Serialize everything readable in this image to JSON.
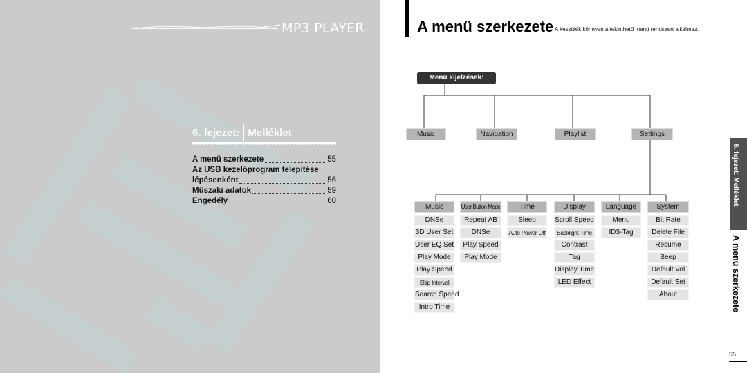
{
  "left_page": {
    "logo_text": "MP3 PLAYER",
    "chapter": {
      "number": "6. fejezet:",
      "name": "Melléklet"
    },
    "toc": [
      {
        "title": "A menü szerkezete",
        "page": "55"
      },
      {
        "title": "Az USB kezelőprogram telepítése",
        "page": ""
      },
      {
        "title": "lépésenként",
        "page": "56"
      },
      {
        "title": "Műszaki adatok",
        "page": "59"
      },
      {
        "title": "Engedély",
        "page": "60"
      }
    ]
  },
  "right_page": {
    "title": "A menü szerkezete",
    "subtitle": "A készülék könnyen áttekinthető menü rendszert alkalmaz.",
    "root": "Menü kijelzések:",
    "level1": [
      "Music",
      "Navigation",
      "Playlist",
      "Settings"
    ],
    "settings_children": [
      {
        "label": "Music",
        "items": [
          "DNSe",
          "3D User Set",
          "User EQ Set",
          "Play Mode",
          "Play Speed",
          "Skip Interval",
          "Search Speed",
          "Intro Time"
        ]
      },
      {
        "label": "User Button Mode",
        "items": [
          "Repeat AB",
          "DNSe",
          "Play Speed",
          "Play Mode"
        ]
      },
      {
        "label": "Time",
        "items": [
          "Sleep",
          "Auto Power Off"
        ]
      },
      {
        "label": "Display",
        "items": [
          "Scroll Speed",
          "Backlight Time",
          "Contrast",
          "Tag",
          "Display Time",
          "LED Effect"
        ]
      },
      {
        "label": "Language",
        "items": [
          "Menu",
          "ID3-Tag"
        ]
      },
      {
        "label": "System",
        "items": [
          "Bit Rate",
          "Delete File",
          "Resume",
          "Beep",
          "Default Vol",
          "Default Set",
          "About"
        ]
      }
    ],
    "side_tab": "6. fejezet: Melléklet",
    "side_title": "A menü szerkezete",
    "page_number": "55"
  }
}
